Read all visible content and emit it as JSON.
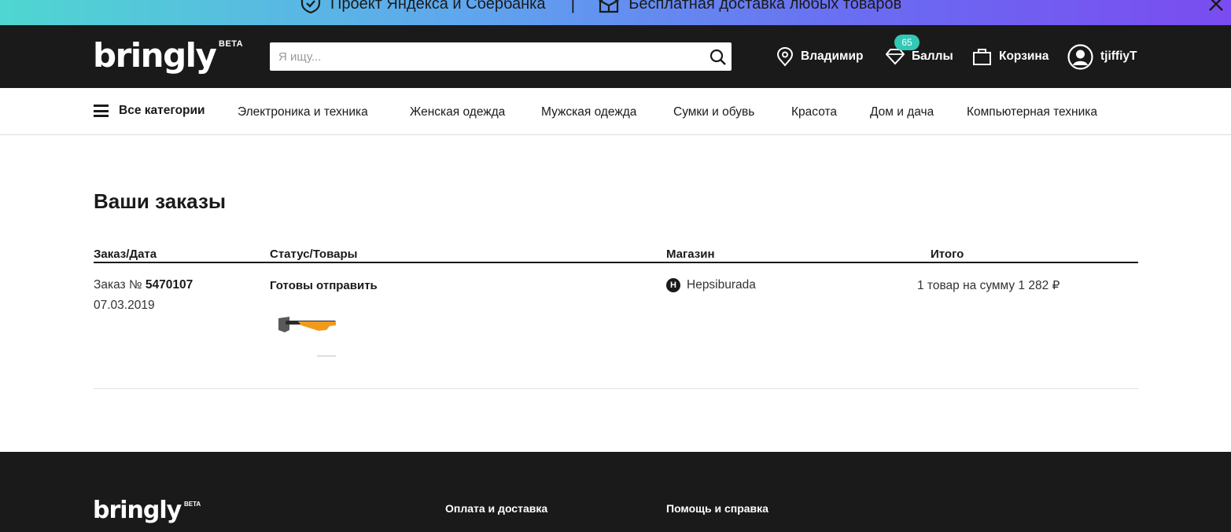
{
  "promo": {
    "text_left": "Проект Яндекса и Сбербанка",
    "separator": "|",
    "text_right": "Бесплатная доставка любых товаров"
  },
  "header": {
    "logo": "bringly",
    "logo_badge": "BETA",
    "search_placeholder": "Я ищу...",
    "city": "Владимир",
    "points_label": "Баллы",
    "points_count": "65",
    "cart_label": "Корзина",
    "username": "tjiffiyT"
  },
  "nav": {
    "all_categories": "Все категории",
    "categories": [
      "Электроника и техника",
      "Женская одежда",
      "Мужская одежда",
      "Сумки и обувь",
      "Красота",
      "Дом и дача",
      "Компьютерная техника"
    ]
  },
  "orders": {
    "title": "Ваши заказы",
    "columns": [
      "Заказ/Дата",
      "Статус/Товары",
      "Магазин",
      "Итого"
    ],
    "rows": [
      {
        "order_prefix": "Заказ №",
        "order_number": "5470107",
        "date": "07.03.2019",
        "status": "Готовы отправить",
        "store_initial": "H",
        "store": "Hepsiburada",
        "total": "1 товар на сумму 1 282 ₽"
      }
    ]
  },
  "footer": {
    "logo": "bringly",
    "logo_badge": "BETA",
    "links": [
      "Оплата и доставка",
      "Помощь и справка"
    ]
  },
  "colors": {
    "header_bg": "#1a1a1a",
    "badge": "#31c8b5",
    "promo_gradient_start": "#4fd6d1",
    "promo_gradient_end": "#7a4cf0"
  }
}
